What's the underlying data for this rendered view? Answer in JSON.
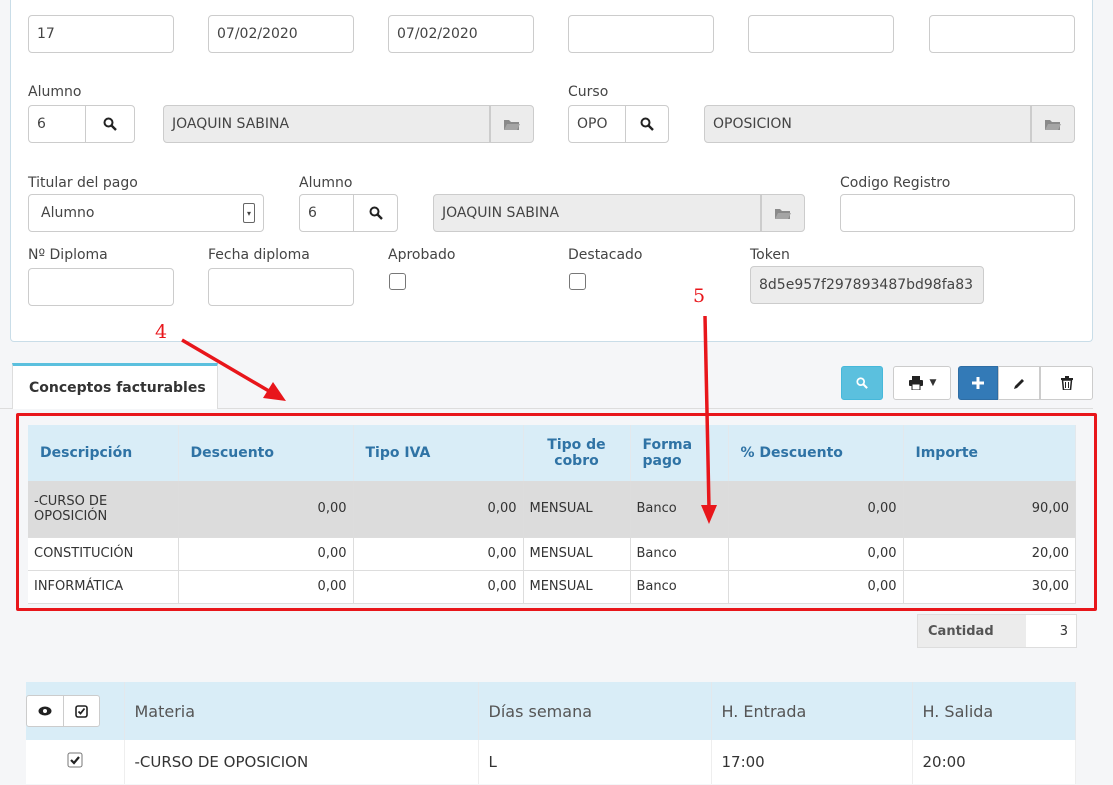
{
  "top_row": {
    "field1": "17",
    "field2": "07/02/2020",
    "field3": "07/02/2020",
    "field4": "",
    "field5": "",
    "field6": ""
  },
  "alumno": {
    "label": "Alumno",
    "code": "6",
    "name": "JOAQUIN SABINA"
  },
  "curso": {
    "label": "Curso",
    "code": "OPO",
    "name": "OPOSICION"
  },
  "titular": {
    "label": "Titular del pago",
    "value": "Alumno"
  },
  "alumno2": {
    "label": "Alumno",
    "code": "6",
    "name": "JOAQUIN SABINA"
  },
  "codigo_registro": {
    "label": "Codigo Registro",
    "value": ""
  },
  "diploma": {
    "label": "Nº Diploma",
    "value": ""
  },
  "fecha_diploma": {
    "label": "Fecha diploma",
    "value": ""
  },
  "aprobado": {
    "label": "Aprobado",
    "checked": false
  },
  "destacado": {
    "label": "Destacado",
    "checked": false
  },
  "token": {
    "label": "Token",
    "value": "8d5e957f297893487bd98fa83"
  },
  "annotations": {
    "a4": "4",
    "a5": "5"
  },
  "tab": {
    "label": "Conceptos facturables"
  },
  "conceptos": {
    "headers": [
      "Descripción",
      "Descuento",
      "Tipo IVA",
      "Tipo de cobro",
      "Forma pago",
      "% Descuento",
      "Importe"
    ],
    "rows": [
      {
        "descripcion": "-CURSO DE OPOSICIÓN",
        "descuento": "0,00",
        "tipo_iva": "0,00",
        "tipo_cobro": "MENSUAL",
        "forma_pago": "Banco",
        "pct_descuento": "0,00",
        "importe": "90,00"
      },
      {
        "descripcion": "CONSTITUCIÓN",
        "descuento": "0,00",
        "tipo_iva": "0,00",
        "tipo_cobro": "MENSUAL",
        "forma_pago": "Banco",
        "pct_descuento": "0,00",
        "importe": "20,00"
      },
      {
        "descripcion": "INFORMÁTICA",
        "descuento": "0,00",
        "tipo_iva": "0,00",
        "tipo_cobro": "MENSUAL",
        "forma_pago": "Banco",
        "pct_descuento": "0,00",
        "importe": "30,00"
      }
    ]
  },
  "cantidad": {
    "label": "Cantidad",
    "value": "3"
  },
  "materias": {
    "headers": [
      "Materia",
      "Días semana",
      "H. Entrada",
      "H. Salida"
    ],
    "rows": [
      {
        "checked": true,
        "materia": "-CURSO DE OPOSICION",
        "dias": "L",
        "entrada": "17:00",
        "salida": "20:00"
      }
    ]
  },
  "colors": {
    "primary": "#337ab7",
    "info": "#5bc0de",
    "annotation": "#e8161b",
    "header_bg": "#d9edf7"
  },
  "icons": [
    "search-icon",
    "folder-icon",
    "print-icon",
    "plus-icon",
    "pencil-icon",
    "trash-icon",
    "eye-icon",
    "check-square-icon",
    "checkbox-icon"
  ]
}
